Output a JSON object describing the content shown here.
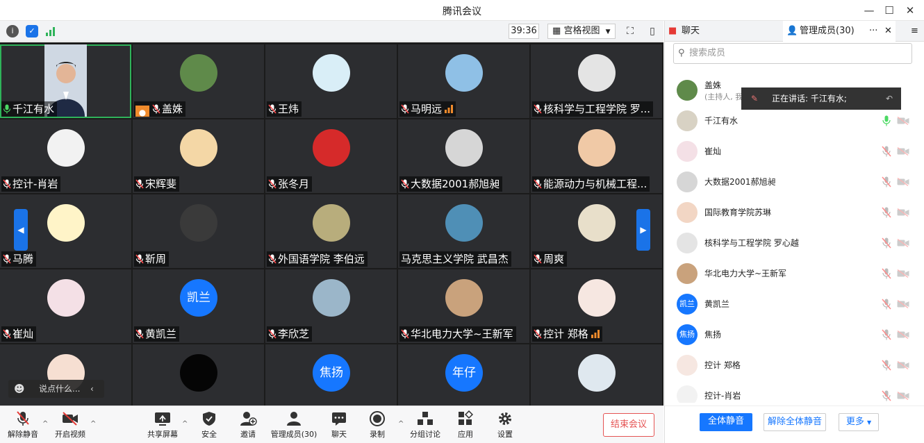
{
  "window": {
    "title": "腾讯会议"
  },
  "topbar": {
    "timer": "39:36",
    "view_label": "宫格视图"
  },
  "tiles": [
    {
      "name": "千江有水",
      "row": 0,
      "col": 0,
      "avatar_color": "#cfd8e3",
      "mic": "on",
      "active": true,
      "video": true
    },
    {
      "name": "盖姝",
      "row": 0,
      "col": 1,
      "avatar_color": "#5f8a4a",
      "mic": "muted",
      "host": true
    },
    {
      "name": "王炜",
      "row": 0,
      "col": 2,
      "avatar_color": "#d9eef7",
      "mic": "muted"
    },
    {
      "name": "马明远",
      "row": 0,
      "col": 3,
      "avatar_color": "#8fc0e6",
      "mic": "muted",
      "signal": true
    },
    {
      "name": "核科学与工程学院 罗...",
      "row": 0,
      "col": 4,
      "avatar_color": "#e4e4e4",
      "mic": "muted"
    },
    {
      "name": "控计-肖岩",
      "row": 1,
      "col": 0,
      "avatar_color": "#f2f2f2",
      "mic": "muted"
    },
    {
      "name": "宋辉斐",
      "row": 1,
      "col": 1,
      "avatar_color": "#f4d7a6",
      "mic": "muted"
    },
    {
      "name": "张冬月",
      "row": 1,
      "col": 2,
      "avatar_color": "#d62a2a",
      "mic": "muted"
    },
    {
      "name": "大数据2001郝旭昶",
      "row": 1,
      "col": 3,
      "avatar_color": "#d6d6d6",
      "mic": "muted"
    },
    {
      "name": "能源动力与机械工程...",
      "row": 1,
      "col": 4,
      "avatar_color": "#f0c9a6",
      "mic": "muted"
    },
    {
      "name": "马腾",
      "row": 2,
      "col": 0,
      "avatar_color": "#fff4c8",
      "mic": "muted"
    },
    {
      "name": "靳周",
      "row": 2,
      "col": 1,
      "avatar_color": "#3a3a3a",
      "mic": "muted"
    },
    {
      "name": "外国语学院 李伯远",
      "row": 2,
      "col": 2,
      "avatar_color": "#b8ad7c",
      "mic": "muted"
    },
    {
      "name": "马克思主义学院 武昌杰",
      "row": 2,
      "col": 3,
      "avatar_color": "#4f8fb6",
      "mic": "none"
    },
    {
      "name": "周爽",
      "row": 2,
      "col": 4,
      "avatar_color": "#e8dfca",
      "mic": "muted"
    },
    {
      "name": "崔灿",
      "row": 3,
      "col": 0,
      "avatar_color": "#f4e0e6",
      "mic": "muted"
    },
    {
      "name": "黄凯兰",
      "row": 3,
      "col": 1,
      "avatar_color": "#1677ff",
      "avatar_text": "凯兰",
      "mic": "muted"
    },
    {
      "name": "李欣芝",
      "row": 3,
      "col": 2,
      "avatar_color": "#9bb6c9",
      "mic": "muted"
    },
    {
      "name": "华北电力大学~王新军",
      "row": 3,
      "col": 3,
      "avatar_color": "#c9a27c",
      "mic": "muted"
    },
    {
      "name": "控计 郑格",
      "row": 3,
      "col": 4,
      "avatar_color": "#f6e7e1",
      "mic": "muted",
      "signal": true
    },
    {
      "name": "",
      "row": 4,
      "col": 0,
      "avatar_color": "#f6dfd2",
      "mic": "none"
    },
    {
      "name": "",
      "row": 4,
      "col": 1,
      "avatar_color": "#050505",
      "mic": "none"
    },
    {
      "name": "",
      "row": 4,
      "col": 2,
      "avatar_color": "#1677ff",
      "avatar_text": "焦扬",
      "mic": "none"
    },
    {
      "name": "",
      "row": 4,
      "col": 3,
      "avatar_color": "#1677ff",
      "avatar_text": "年仔",
      "mic": "none"
    },
    {
      "name": "",
      "row": 4,
      "col": 4,
      "avatar_color": "#dfe8ef",
      "mic": "none"
    }
  ],
  "chat_overlay": {
    "placeholder": "说点什么..."
  },
  "toolbar": {
    "unmute": "解除静音",
    "start_video": "开启视频",
    "share_screen": "共享屏幕",
    "security": "安全",
    "invite": "邀请",
    "manage_members": "管理成员(30)",
    "chat": "聊天",
    "record": "录制",
    "breakout": "分组讨论",
    "apps": "应用",
    "settings": "设置",
    "end_meeting": "结束会议"
  },
  "panel": {
    "tab_chat": "聊天",
    "tab_members": "管理成员(30)",
    "search_placeholder": "搜索成员",
    "speaking": "正在讲话: 千江有水;",
    "members": [
      {
        "name": "盖姝",
        "sub": "(主持人, 我)",
        "avatar_color": "#5f8a4a",
        "mic": "host"
      },
      {
        "name": "千江有水",
        "avatar_color": "#d8d2c4",
        "mic": "on"
      },
      {
        "name": "崔灿",
        "avatar_color": "#f4e0e6",
        "mic": "muted"
      },
      {
        "name": "大数据2001郝旭昶",
        "avatar_color": "#d6d6d6",
        "mic": "muted"
      },
      {
        "name": "国际教育学院苏琳",
        "avatar_color": "#f2d6c4",
        "mic": "muted"
      },
      {
        "name": "核科学与工程学院 罗心越",
        "avatar_color": "#e4e4e4",
        "mic": "muted"
      },
      {
        "name": "华北电力大学~王新军",
        "avatar_color": "#c9a27c",
        "mic": "muted"
      },
      {
        "name": "黄凯兰",
        "avatar_color": "#1677ff",
        "avatar_text": "凯兰",
        "mic": "muted"
      },
      {
        "name": "焦扬",
        "avatar_color": "#1677ff",
        "avatar_text": "焦扬",
        "mic": "muted"
      },
      {
        "name": "控计 郑格",
        "avatar_color": "#f6e7e1",
        "mic": "muted"
      },
      {
        "name": "控计-肖岩",
        "avatar_color": "#f2f2f2",
        "mic": "muted"
      }
    ],
    "mute_all": "全体静音",
    "unmute_all": "解除全体静音",
    "more": "更多"
  }
}
